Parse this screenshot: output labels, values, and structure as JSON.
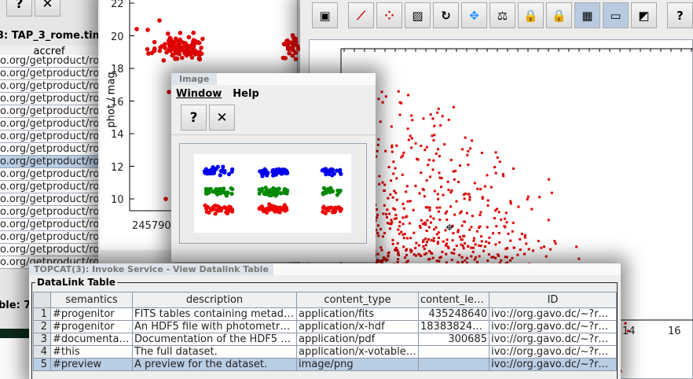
{
  "table_window": {
    "title": "3: TAP_3_rome.time_",
    "column_header": "accref",
    "rows": [
      "o.org/getproduct/ror",
      "o.org/getproduct/ror",
      "o.org/getproduct/ror",
      "o.org/getproduct/ror",
      "o.org/getproduct/ror",
      "o.org/getproduct/ror",
      "o.org/getproduct/ror",
      "o.org/getproduct/ror",
      "o.org/getproduct/ror",
      "o.org/getproduct/ror",
      "o.org/getproduct/ror",
      "o.org/getproduct/ror",
      "o.org/getproduct/ror",
      "o.org/getproduct/ror",
      "o.org/getproduct/ror",
      "o.org/getproduct/ror",
      "o.org/getproduct/ror"
    ],
    "selected_row": 8,
    "status": "ble: 7,0"
  },
  "lightcurve_plot": {
    "ylabel": "phot / mag",
    "y_ticks": [
      "22",
      "20",
      "18",
      "16",
      "14",
      "12",
      "10"
    ],
    "x_ticks": [
      "2457900"
    ],
    "point_color": "#e00000"
  },
  "main_plot": {
    "toolbar_icons": [
      "float-window-icon",
      "line-plot-icon",
      "blob-subset-icon",
      "rectangle-subset-icon",
      "replot-icon",
      "navigation-icon",
      "ruler-icon",
      "axis-lock-icon",
      "aux-lock-icon",
      "density-shading-icon",
      "progress-bar-icon",
      "export-icon",
      "help-icon"
    ],
    "active_toolbar": [
      "density-shading-icon",
      "progress-bar-icon"
    ],
    "y_ticks": [
      "14"
    ],
    "x_ticks": [
      "14",
      "16"
    ],
    "point_color": "#e00000"
  },
  "image_window": {
    "title": "Image",
    "menu": [
      "Window",
      "Help"
    ],
    "buttons": {
      "help": "?",
      "close": "✕"
    },
    "series_colors": [
      "#0000ee",
      "#008800",
      "#ee0000"
    ]
  },
  "datalink_window": {
    "title": "TOPCAT(3): Invoke Service - View Datalink Table",
    "panel_label": "DataLink Table",
    "columns": [
      "semantics",
      "description",
      "content_type",
      "content_length",
      "ID"
    ],
    "rows": [
      {
        "n": "1",
        "semantics": "#progenitor",
        "description": "FITS tables containing metadata fo...",
        "content_type": "application/fits",
        "content_length": "435248640",
        "ID": "ivo://org.gavo.dc/~?rome/ts/"
      },
      {
        "n": "2",
        "semantics": "#progenitor",
        "description": "An HDF5 file with photometry for th...",
        "content_type": "application/x-hdf",
        "content_length": "18383824760",
        "ID": "ivo://org.gavo.dc/~?rome/ts/"
      },
      {
        "n": "3",
        "semantics": "#documentation",
        "description": "Documentation of the HDF5 files a...",
        "content_type": "application/pdf",
        "content_length": "300685",
        "ID": "ivo://org.gavo.dc/~?rome/ts/"
      },
      {
        "n": "4",
        "semantics": "#this",
        "description": "The full dataset.",
        "content_type": "application/x-votable+xml",
        "content_length": "",
        "ID": "ivo://org.gavo.dc/~?rome/ts/"
      },
      {
        "n": "5",
        "semantics": "#preview",
        "description": "A preview for the dataset.",
        "content_type": "image/png",
        "content_length": "",
        "ID": "ivo://org.gavo.dc/~?rome/ts/"
      }
    ],
    "selected_row": 5
  }
}
